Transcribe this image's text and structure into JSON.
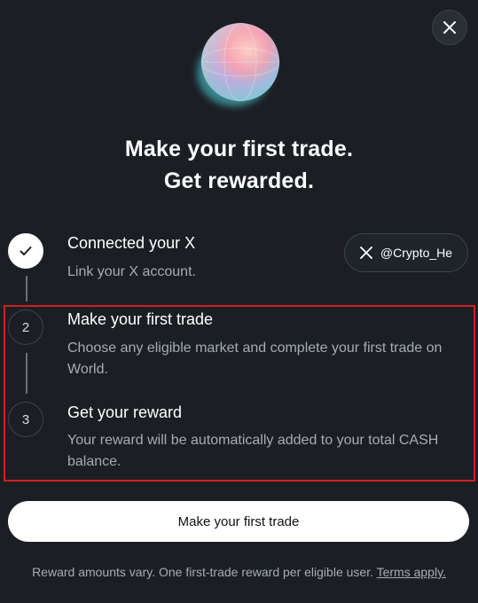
{
  "dialog": {
    "close_icon": "close-icon",
    "headline_line1": "Make your first trade.",
    "headline_line2": "Get rewarded."
  },
  "steps": [
    {
      "marker": "",
      "marker_icon": "checkmark-icon",
      "status": "complete",
      "title": "Connected your X",
      "description": "Link your X account.",
      "account_handle": "@Crypto_He",
      "account_icon": "x-logo-icon"
    },
    {
      "marker": "2",
      "status": "pending",
      "title": "Make your first trade",
      "description": "Choose any eligible market and complete your first trade on World."
    },
    {
      "marker": "3",
      "status": "pending",
      "title": "Get your reward",
      "description": "Your reward will be automatically added to your total CASH balance."
    }
  ],
  "cta": {
    "label": "Make your first trade"
  },
  "footer": {
    "text": "Reward amounts vary. One first-trade reward per eligible user.",
    "link_label": "Terms apply."
  },
  "colors": {
    "background": "#1b1f24",
    "highlight_border": "#d0201f",
    "button_bg": "#ffffff",
    "muted_text": "#a6acb3"
  }
}
